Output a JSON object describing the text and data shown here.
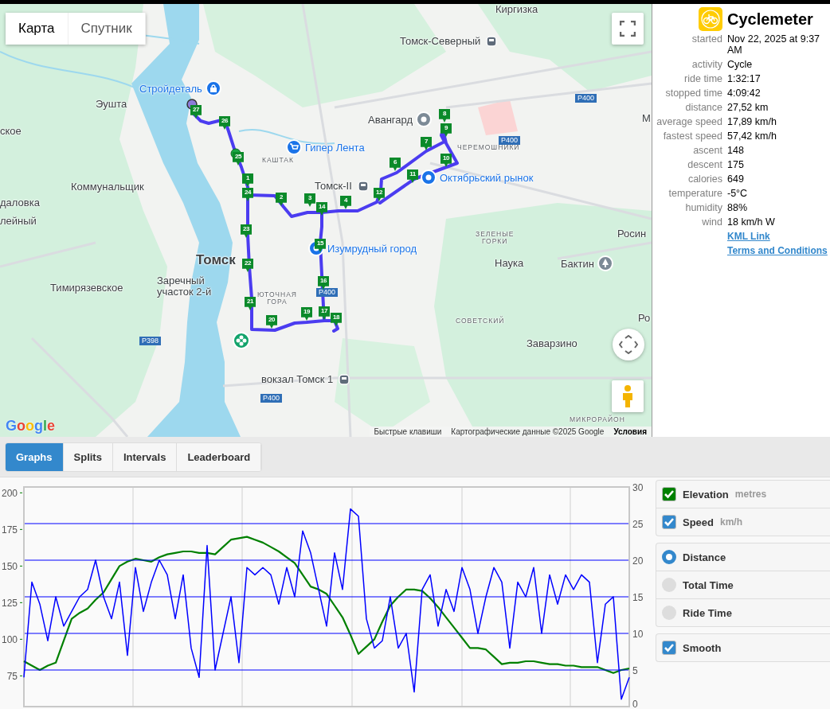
{
  "map": {
    "map_types": [
      {
        "label": "Карта",
        "selected": true
      },
      {
        "label": "Спутник",
        "selected": false
      }
    ],
    "labels": [
      {
        "text": "Киргизка",
        "kind": "town"
      },
      {
        "text": "Томск-Северный",
        "kind": "town"
      },
      {
        "text": "Стройдеталь",
        "kind": "poi"
      },
      {
        "text": "Эушта",
        "kind": "town"
      },
      {
        "text": "ское",
        "kind": "town"
      },
      {
        "text": "Гипер Лента",
        "kind": "poi"
      },
      {
        "text": "Авангард",
        "kind": "town"
      },
      {
        "text": "ЧЕРЕМОШНИКИ",
        "kind": "district"
      },
      {
        "text": "Р400",
        "kind": "road"
      },
      {
        "text": "Р400",
        "kind": "road"
      },
      {
        "text": "КАШТАК",
        "kind": "district"
      },
      {
        "text": "Томск-II",
        "kind": "town"
      },
      {
        "text": "Октябрьский рынок",
        "kind": "poi"
      },
      {
        "text": "Коммунальщик",
        "kind": "town"
      },
      {
        "text": "даловка",
        "kind": "town"
      },
      {
        "text": "лейный",
        "kind": "town"
      },
      {
        "text": "М",
        "kind": "town"
      },
      {
        "text": "Томск",
        "kind": "city"
      },
      {
        "text": "Изумрудный город",
        "kind": "poi"
      },
      {
        "text": "ЗЕЛЕНЫЕ\nГОРКИ",
        "kind": "district"
      },
      {
        "text": "Росин",
        "kind": "town"
      },
      {
        "text": "Наука",
        "kind": "town"
      },
      {
        "text": "Бактин",
        "kind": "town"
      },
      {
        "text": "Тимирязевское",
        "kind": "town"
      },
      {
        "text": "Заречный\nучасток 2-й",
        "kind": "town"
      },
      {
        "text": "ЮТОЧНАЯ\nГОРА",
        "kind": "district"
      },
      {
        "text": "Р400",
        "kind": "road"
      },
      {
        "text": "СОВЕТСКИЙ",
        "kind": "district"
      },
      {
        "text": "Ро",
        "kind": "town"
      },
      {
        "text": "Р398",
        "kind": "road"
      },
      {
        "text": "Заварзино",
        "kind": "town"
      },
      {
        "text": "вокзал Томск 1",
        "kind": "town"
      },
      {
        "text": "Р400",
        "kind": "road"
      },
      {
        "text": "МИКРОРАЙОН",
        "kind": "district"
      }
    ],
    "route_markers": [
      "27",
      "8",
      "26",
      "9",
      "7",
      "25",
      "10",
      "6",
      "11",
      "1",
      "24",
      "12",
      "2",
      "3",
      "4",
      "14",
      "23",
      "15",
      "22",
      "16",
      "21",
      "19",
      "17",
      "18",
      "20"
    ],
    "logo": "Google",
    "attribution": [
      "Быстрые клавиши",
      "Картографические данные ©2025 Google",
      "Условия"
    ]
  },
  "summary": {
    "title": "Cyclemeter",
    "stats": [
      {
        "label": "started",
        "value": "Nov 22, 2025 at 9:37 AM"
      },
      {
        "label": "activity",
        "value": "Cycle"
      },
      {
        "label": "ride time",
        "value": "1:32:17"
      },
      {
        "label": "stopped time",
        "value": "4:09:42"
      },
      {
        "label": "distance",
        "value": "27,52 km"
      },
      {
        "label": "average speed",
        "value": "17,89 km/h"
      },
      {
        "label": "fastest speed",
        "value": "57,42 km/h"
      },
      {
        "label": "ascent",
        "value": "148"
      },
      {
        "label": "descent",
        "value": "175"
      },
      {
        "label": "calories",
        "value": "649"
      },
      {
        "label": "temperature",
        "value": "-5°C"
      },
      {
        "label": "humidity",
        "value": "88%"
      },
      {
        "label": "wind",
        "value": "18 km/h W"
      }
    ],
    "links": [
      "KML Link",
      "Terms and Conditions"
    ]
  },
  "tabs": [
    {
      "label": "Graphs",
      "selected": true
    },
    {
      "label": "Splits",
      "selected": false
    },
    {
      "label": "Intervals",
      "selected": false
    },
    {
      "label": "Leaderboard",
      "selected": false
    }
  ],
  "graph": {
    "elevation": {
      "chart_data": {
        "type": "line",
        "grid": true,
        "ylim": [
          54,
          204
        ],
        "yticks": [
          75,
          100,
          125,
          150,
          175,
          200
        ],
        "series": [
          {
            "name": "Elevation",
            "color": "#008000",
            "values": [
              85,
              82,
              79,
              82,
              84,
              99,
              114,
              118,
              121,
              127,
              132,
              141,
              150,
              153,
              155,
              154,
              153,
              156,
              158,
              159,
              160,
              160,
              159,
              159,
              158,
              163,
              168,
              169,
              170,
              168,
              166,
              163,
              160,
              156,
              152,
              144,
              136,
              134,
              131,
              123,
              115,
              103,
              90,
              95,
              100,
              112,
              123,
              129,
              134,
              134,
              133,
              128,
              122,
              115,
              108,
              101,
              94,
              94,
              93,
              88,
              83,
              84,
              84,
              85,
              85,
              84,
              83,
              83,
              82,
              82,
              81,
              81,
              81,
              79,
              77,
              79,
              80
            ]
          }
        ]
      }
    },
    "speed": {
      "chart_data": {
        "type": "line",
        "grid": true,
        "ylim": [
          0,
          30
        ],
        "yticks": [
          0,
          5,
          10,
          15,
          20,
          25,
          30
        ],
        "series": [
          {
            "name": "Speed",
            "color": "#0000ff",
            "values": [
              4,
              17,
              14,
              9,
              15,
              11,
              13,
              15,
              16,
              20,
              15,
              12,
              17,
              7,
              19,
              13,
              17,
              20,
              18,
              12,
              18,
              8,
              4,
              22,
              5,
              10,
              15,
              6,
              19,
              18,
              19,
              18,
              14,
              19,
              15,
              24,
              21,
              16,
              11,
              21,
              16,
              27,
              26,
              12,
              8,
              9,
              15,
              8,
              10,
              2,
              16,
              18,
              11,
              16,
              13,
              19,
              16,
              10,
              15,
              19,
              17,
              8,
              17,
              15,
              19,
              10,
              18,
              14,
              18,
              16,
              18,
              17,
              6,
              14,
              15,
              1,
              4
            ]
          }
        ]
      }
    }
  },
  "legend": {
    "groups": [
      {
        "items": [
          {
            "kind": "checkbox",
            "unit": "metres",
            "checked": true,
            "color": "#008000"
          },
          {
            "kind": "checkbox",
            "unit": "km/h",
            "checked": true,
            "color": "#3388cc"
          }
        ]
      },
      {
        "items": [
          {
            "kind": "radio",
            "label": "Distance",
            "selected": true
          },
          {
            "kind": "radio",
            "label": "Total Time",
            "selected": false
          },
          {
            "kind": "radio",
            "label": "Ride Time",
            "selected": false
          }
        ]
      },
      {
        "items": [
          {
            "kind": "checkbox",
            "label": "Smooth",
            "checked": true,
            "color": "#3388cc"
          }
        ]
      }
    ]
  }
}
